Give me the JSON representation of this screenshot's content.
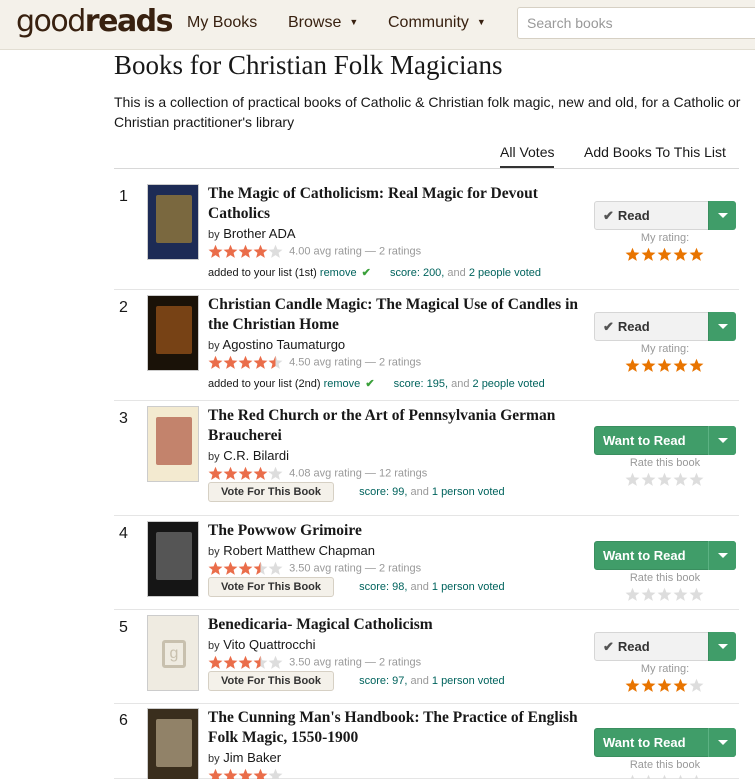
{
  "header": {
    "logo_a": "good",
    "logo_b": "reads",
    "nav": [
      "My Books",
      "Browse",
      "Community"
    ],
    "search_placeholder": "Search books"
  },
  "list": {
    "title": "Books for Christian Folk Magicians",
    "description": "This is a collection of practical books of Catholic & Christian folk magic, new and old, for a Catholic or Christian practitioner's library",
    "tabs": [
      "All Votes",
      "Add Books To This List"
    ]
  },
  "colors": {
    "star": "#e87400",
    "star_alt": "#ea6d4a",
    "green": "#409d69",
    "link": "#00635d"
  },
  "books": [
    {
      "rank": "1",
      "title": "The Magic of Catholicism: Real Magic for Devout Catholics",
      "by": "by",
      "author": "Brother ADA",
      "avg_stars": 4.0,
      "rating_text": "4.00 avg rating — 2 ratings",
      "added": "added to your list (1st)",
      "remove": "remove",
      "score": "score: 200,",
      "and": "and",
      "voted": "2 people voted",
      "shelf": "Read",
      "rating_label": "My rating:",
      "my_stars": 5
    },
    {
      "rank": "2",
      "title": "Christian Candle Magic: The Magical Use of Candles in the Christian Home",
      "by": "by",
      "author": "Agostino Taumaturgo",
      "avg_stars": 4.5,
      "rating_text": "4.50 avg rating — 2 ratings",
      "added": "added to your list (2nd)",
      "remove": "remove",
      "score": "score: 195,",
      "and": "and",
      "voted": "2 people voted",
      "shelf": "Read",
      "rating_label": "My rating:",
      "my_stars": 5
    },
    {
      "rank": "3",
      "title": "The Red Church or the Art of Pennsylvania German Braucherei",
      "by": "by",
      "author": "C.R. Bilardi",
      "avg_stars": 4.08,
      "rating_text": "4.08 avg rating — 12 ratings",
      "vote_label": "Vote For This Book",
      "score": "score: 99,",
      "and": "and",
      "voted": "1 person voted",
      "shelf": "Want to Read",
      "rating_label": "Rate this book",
      "my_stars": 0
    },
    {
      "rank": "4",
      "title": "The Powwow Grimoire",
      "by": "by",
      "author": "Robert Matthew Chapman",
      "avg_stars": 3.5,
      "rating_text": "3.50 avg rating — 2 ratings",
      "vote_label": "Vote For This Book",
      "score": "score: 98,",
      "and": "and",
      "voted": "1 person voted",
      "shelf": "Want to Read",
      "rating_label": "Rate this book",
      "my_stars": 0
    },
    {
      "rank": "5",
      "title": "Benedicaria- Magical Catholicism",
      "by": "by",
      "author": "Vito Quattrocchi",
      "avg_stars": 3.5,
      "rating_text": "3.50 avg rating — 2 ratings",
      "vote_label": "Vote For This Book",
      "score": "score: 97,",
      "and": "and",
      "voted": "1 person voted",
      "shelf": "Read",
      "rating_label": "My rating:",
      "my_stars": 4
    },
    {
      "rank": "6",
      "title": "The Cunning Man's Handbook: The Practice of English Folk Magic, 1550-1900",
      "by": "by",
      "author": "Jim Baker",
      "avg_stars": 4.0,
      "rating_text": "",
      "shelf": "Want to Read",
      "rating_label": "Rate this book",
      "my_stars": 0
    }
  ]
}
